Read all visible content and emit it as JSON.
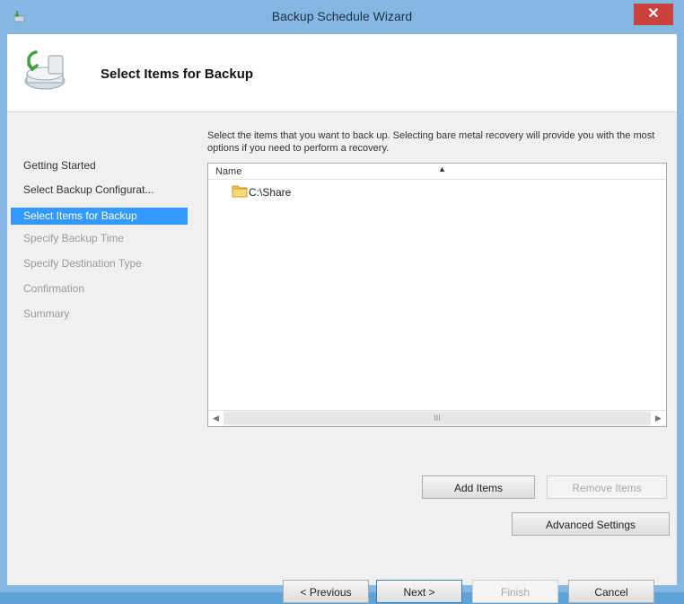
{
  "window": {
    "title": "Backup Schedule Wizard",
    "close_glyph": "✕"
  },
  "header": {
    "title": "Select Items for Backup",
    "icon": "backup-wizard-icon"
  },
  "nav": {
    "items": [
      {
        "label": "Getting Started",
        "state": "done"
      },
      {
        "label": "Select Backup Configurat...",
        "state": "done"
      },
      {
        "label": "Select Items for Backup",
        "state": "current"
      },
      {
        "label": "Specify Backup Time",
        "state": "todo"
      },
      {
        "label": "Specify Destination Type",
        "state": "todo"
      },
      {
        "label": "Confirmation",
        "state": "todo"
      },
      {
        "label": "Summary",
        "state": "todo"
      }
    ]
  },
  "content": {
    "description": "Select the items that you want to back up. Selecting bare metal recovery will provide you with the most options if you need to perform a recovery.",
    "list": {
      "column_name": "Name",
      "sort_glyph": "▲",
      "items": [
        {
          "label": "C:\\Share",
          "icon": "folder-icon"
        }
      ],
      "scroll_left": "◀",
      "scroll_right": "▶",
      "scroll_thumb": "III"
    },
    "buttons": {
      "add_items": "Add Items",
      "remove_items": "Remove Items",
      "advanced_settings": "Advanced Settings"
    }
  },
  "footer": {
    "previous": "< Previous",
    "next": "Next >",
    "finish": "Finish",
    "cancel": "Cancel"
  },
  "colors": {
    "accent": "#3399ff",
    "frame": "#84b8e2",
    "close": "#c9433b"
  }
}
